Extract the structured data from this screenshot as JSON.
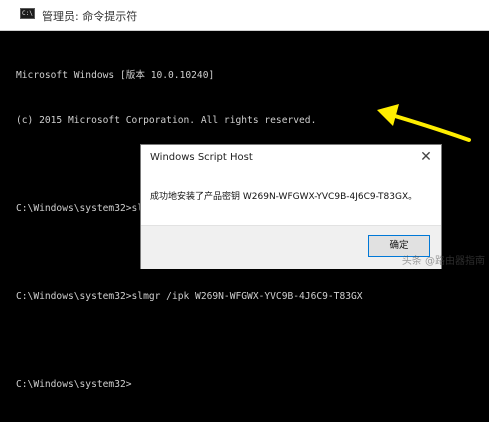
{
  "window": {
    "title": "管理员: 命令提示符",
    "icon": "cmd-icon",
    "icon_glyph": "C:\\",
    "console_lines": [
      "Microsoft Windows [版本 10.0.10240]",
      "(c) 2015 Microsoft Corporation. All rights reserved.",
      "",
      "C:\\Windows\\system32>slmgr.vbs /upk",
      "",
      "C:\\Windows\\system32>slmgr /ipk W269N-WFGWX-YVC9B-4J6C9-T83GX",
      "",
      "C:\\Windows\\system32>"
    ]
  },
  "annotation": {
    "icon": "arrow-icon",
    "color": "#ffee00"
  },
  "dialog": {
    "title": "Windows Script Host",
    "close_icon": "close-icon",
    "message": "成功地安装了产品密钥 W269N-WFGWX-YVC9B-4J6C9-T83GX。",
    "ok_label": "确定"
  },
  "watermark": {
    "text": "头条 @路由器指南"
  }
}
